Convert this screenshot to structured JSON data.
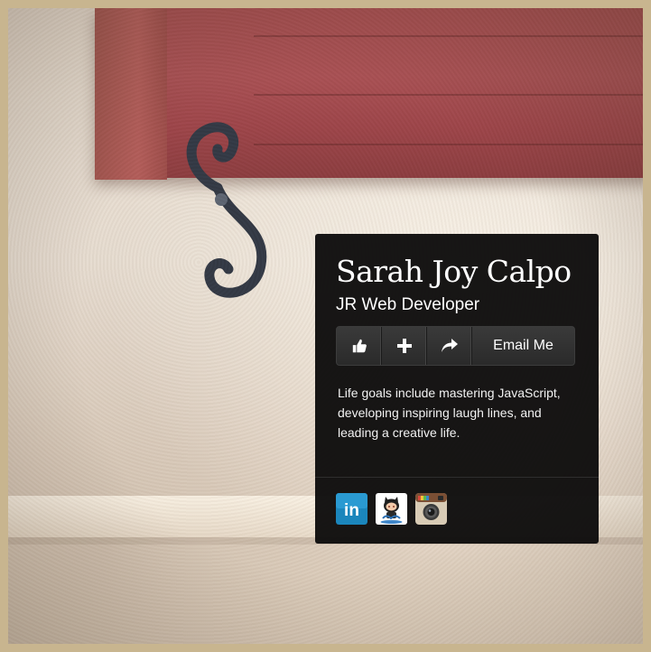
{
  "profile": {
    "name": "Sarah Joy Calpo",
    "role": "JR Web Developer",
    "bio": "Life goals include mastering JavaScript, developing inspiring laugh lines, and leading a creative life."
  },
  "actions": {
    "like_icon": "thumbs-up-icon",
    "add_icon": "plus-icon",
    "share_icon": "share-arrow-icon",
    "email_label": "Email Me"
  },
  "social": [
    {
      "name": "LinkedIn",
      "icon": "linkedin-icon",
      "label": "in"
    },
    {
      "name": "GitHub",
      "icon": "github-octocat-icon"
    },
    {
      "name": "Instagram",
      "icon": "instagram-icon"
    }
  ],
  "colors": {
    "frame": "#c8b58f",
    "card_bg": "#0e0d0d",
    "button_bg": "#333333",
    "linkedin": "#1b86bc"
  }
}
